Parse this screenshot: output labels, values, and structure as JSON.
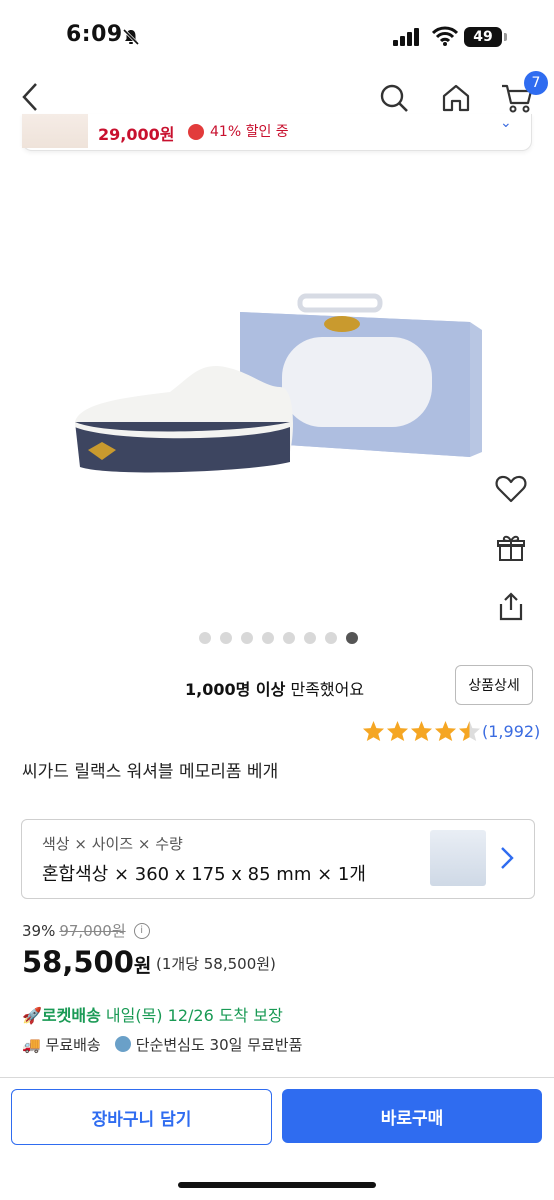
{
  "status": {
    "time": "6:09",
    "battery": "49"
  },
  "nav": {
    "cart_count": "7"
  },
  "mini_banner": {
    "price": "29,000원",
    "discount": "41% 할인 중"
  },
  "gallery": {
    "dot_count": 8,
    "active_index": 7
  },
  "satisfaction": {
    "count": "1,000명 이상",
    "text": "만족했어요"
  },
  "detail_button": "상품상세",
  "rating": {
    "stars": 4.5,
    "review_count": "(1,992)"
  },
  "product_title": "씨가드 릴랙스 워셔블 메모리폼 베개",
  "options": {
    "label": "색상 × 사이즈 × 수량",
    "value": "혼합색상 × 360 x 175 x 85 mm × 1개"
  },
  "pricing": {
    "discount_rate": "39%",
    "original_price": "97,000원",
    "sale_price": "58,500",
    "sale_unit": "원",
    "unit_price": "(1개당 58,500원)"
  },
  "delivery": {
    "rocket_label": "로켓배송",
    "rocket_eta": "내일(목) 12/26 도착 보장",
    "free_shipping": "무료배송",
    "free_return": "단순변심도 30일 무료반품"
  },
  "actions": {
    "cart": "장바구니 담기",
    "buy": "바로구매"
  },
  "colors": {
    "accent": "#2f6cf0",
    "sale_red": "#c8102e",
    "rocket_green": "#1a9a55",
    "star": "#f5a623"
  }
}
